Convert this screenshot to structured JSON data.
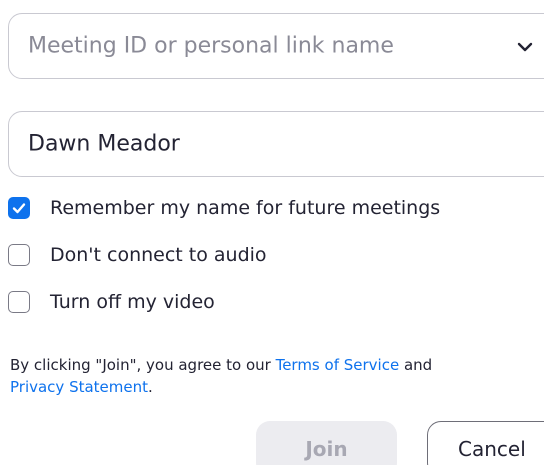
{
  "meeting_field": {
    "placeholder": "Meeting ID or personal link name",
    "dropdown_icon": "chevron-down-icon"
  },
  "name_field": {
    "value": "Dawn Meador"
  },
  "options": [
    {
      "label": "Remember my name for future meetings",
      "checked": true
    },
    {
      "label": "Don't connect to audio",
      "checked": false
    },
    {
      "label": "Turn off my video",
      "checked": false
    }
  ],
  "terms": {
    "prefix": "By clicking \"Join\", you agree to our ",
    "terms_link": "Terms of Service",
    "middle": " and ",
    "privacy_link": "Privacy Statement",
    "suffix": "."
  },
  "buttons": {
    "join": "Join",
    "cancel": "Cancel"
  },
  "colors": {
    "accent": "#0e72ed",
    "border": "#c9c9d1",
    "disabled_bg": "#ececf0"
  }
}
